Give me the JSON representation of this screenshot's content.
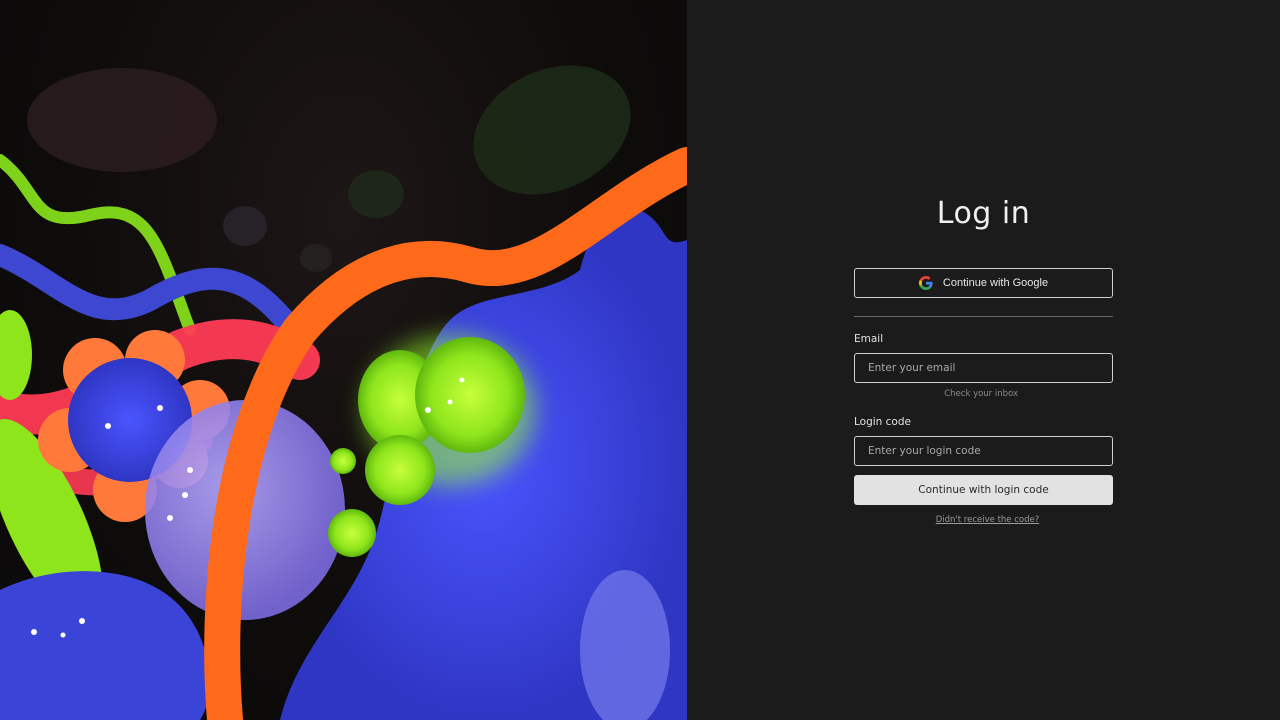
{
  "login": {
    "title": "Log in",
    "google_button_label": "Continue with Google",
    "email_label": "Email",
    "email_placeholder": "Enter your email",
    "email_value": "",
    "email_hint": "Check your inbox",
    "code_label": "Login code",
    "code_placeholder": "Enter your login code",
    "code_value": "",
    "continue_button_label": "Continue with login code",
    "resend_link_label": "Didn't receive the code?"
  },
  "icons": {
    "google": "google-icon"
  },
  "colors": {
    "panel_background": "#1b1b1b",
    "primary_button_bg": "#e2e2e2",
    "illustration_blue": "#3b45d8",
    "illustration_orange": "#ff6a1a",
    "illustration_green": "#8be31b",
    "illustration_pink": "#ff3b5c",
    "illustration_lavender": "#9b8cf0"
  }
}
